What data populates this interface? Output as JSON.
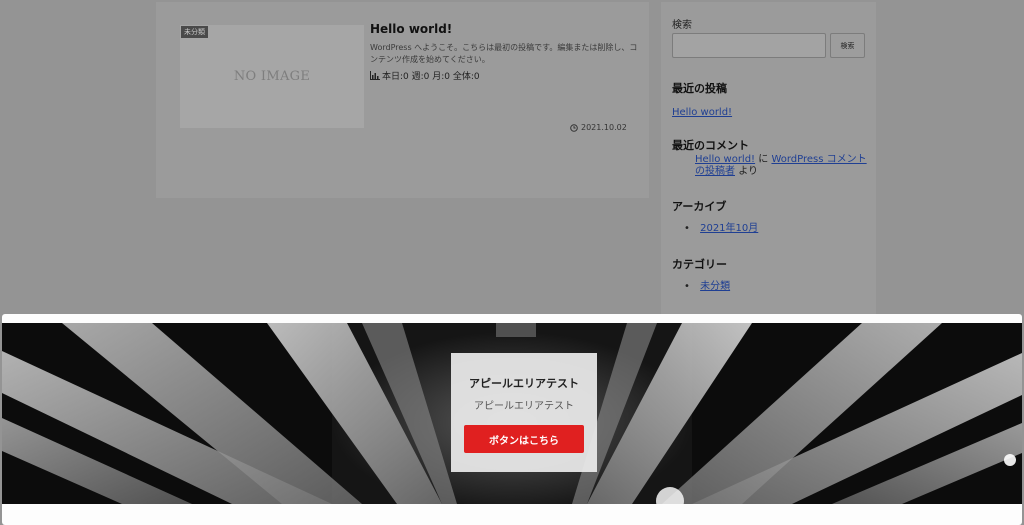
{
  "post": {
    "thumbnail_text": "NO IMAGE",
    "category_badge": "未分類",
    "title": "Hello world!",
    "excerpt": "WordPress へようこそ。こちらは最初の投稿です。編集または削除し、コンテンツ作成を始めてください。",
    "stats": "本日:0 週:0 月:0 全体:0",
    "date": "2021.10.02",
    "stats_icon": "bar-chart-icon",
    "date_icon": "clock-icon"
  },
  "sidebar": {
    "search_label": "検索",
    "search_value": "",
    "search_button": "検索",
    "recent_posts_heading": "最近の投稿",
    "recent_posts": [
      "Hello world!"
    ],
    "recent_comments_heading": "最近のコメント",
    "comment": {
      "post_link": "Hello world!",
      "connector": "に",
      "author_link": "WordPress コメントの投稿者",
      "suffix": "より"
    },
    "archives_heading": "アーカイブ",
    "archives": [
      "2021年10月"
    ],
    "categories_heading": "カテゴリー",
    "categories": [
      "未分類"
    ]
  },
  "appeal": {
    "title": "アピールエリアテスト",
    "subtitle": "アピールエリアテスト",
    "button_label": "ボタンはこちら",
    "button_color": "#e02020"
  }
}
